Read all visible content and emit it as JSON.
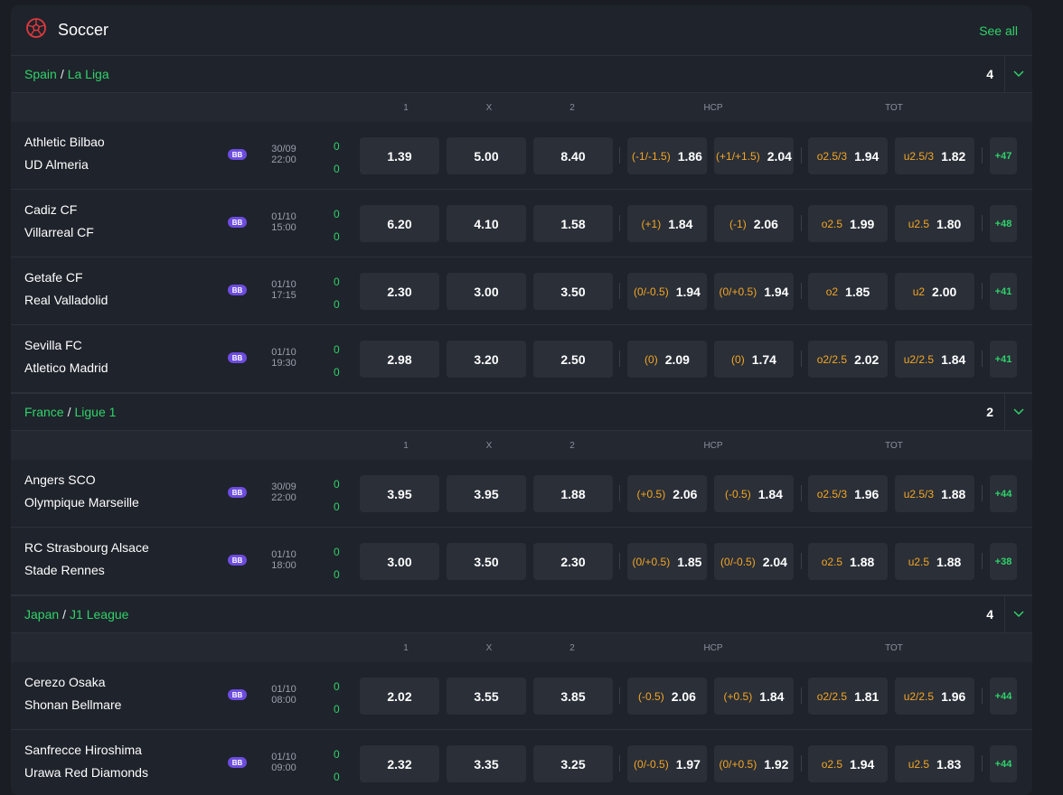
{
  "header": {
    "title": "Soccer",
    "see_all": "See all"
  },
  "columns": {
    "one": "1",
    "x": "X",
    "two": "2",
    "hcp": "HCP",
    "tot": "TOT"
  },
  "colors": {
    "accent": "#2fd36a",
    "line_label": "#f5a623",
    "bb_badge": "#6d4ce0"
  },
  "leagues": [
    {
      "country": "Spain",
      "league": "La Liga",
      "count": "4",
      "matches": [
        {
          "home": "Athletic Bilbao",
          "away": "UD Almeria",
          "badge": "BB",
          "date": "30/09",
          "time": "22:00",
          "score_home": "0",
          "score_away": "0",
          "o1": "1.39",
          "ox": "5.00",
          "o2": "8.40",
          "h1_label": "(-1/-1.5)",
          "h1": "1.86",
          "h2_label": "(+1/+1.5)",
          "h2": "2.04",
          "t1_label": "o2.5/3",
          "t1": "1.94",
          "t2_label": "u2.5/3",
          "t2": "1.82",
          "more": "+47"
        },
        {
          "home": "Cadiz CF",
          "away": "Villarreal CF",
          "badge": "BB",
          "date": "01/10",
          "time": "15:00",
          "score_home": "0",
          "score_away": "0",
          "o1": "6.20",
          "ox": "4.10",
          "o2": "1.58",
          "h1_label": "(+1)",
          "h1": "1.84",
          "h2_label": "(-1)",
          "h2": "2.06",
          "t1_label": "o2.5",
          "t1": "1.99",
          "t2_label": "u2.5",
          "t2": "1.80",
          "more": "+48"
        },
        {
          "home": "Getafe CF",
          "away": "Real Valladolid",
          "badge": "BB",
          "date": "01/10",
          "time": "17:15",
          "score_home": "0",
          "score_away": "0",
          "o1": "2.30",
          "ox": "3.00",
          "o2": "3.50",
          "h1_label": "(0/-0.5)",
          "h1": "1.94",
          "h2_label": "(0/+0.5)",
          "h2": "1.94",
          "t1_label": "o2",
          "t1": "1.85",
          "t2_label": "u2",
          "t2": "2.00",
          "more": "+41"
        },
        {
          "home": "Sevilla FC",
          "away": "Atletico Madrid",
          "badge": "BB",
          "date": "01/10",
          "time": "19:30",
          "score_home": "0",
          "score_away": "0",
          "o1": "2.98",
          "ox": "3.20",
          "o2": "2.50",
          "h1_label": "(0)",
          "h1": "2.09",
          "h2_label": "(0)",
          "h2": "1.74",
          "t1_label": "o2/2.5",
          "t1": "2.02",
          "t2_label": "u2/2.5",
          "t2": "1.84",
          "more": "+41"
        }
      ]
    },
    {
      "country": "France",
      "league": "Ligue 1",
      "count": "2",
      "matches": [
        {
          "home": "Angers SCO",
          "away": "Olympique Marseille",
          "badge": "BB",
          "date": "30/09",
          "time": "22:00",
          "score_home": "0",
          "score_away": "0",
          "o1": "3.95",
          "ox": "3.95",
          "o2": "1.88",
          "h1_label": "(+0.5)",
          "h1": "2.06",
          "h2_label": "(-0.5)",
          "h2": "1.84",
          "t1_label": "o2.5/3",
          "t1": "1.96",
          "t2_label": "u2.5/3",
          "t2": "1.88",
          "more": "+44"
        },
        {
          "home": "RC Strasbourg Alsace",
          "away": "Stade Rennes",
          "badge": "BB",
          "date": "01/10",
          "time": "18:00",
          "score_home": "0",
          "score_away": "0",
          "o1": "3.00",
          "ox": "3.50",
          "o2": "2.30",
          "h1_label": "(0/+0.5)",
          "h1": "1.85",
          "h2_label": "(0/-0.5)",
          "h2": "2.04",
          "t1_label": "o2.5",
          "t1": "1.88",
          "t2_label": "u2.5",
          "t2": "1.88",
          "more": "+38"
        }
      ]
    },
    {
      "country": "Japan",
      "league": "J1 League",
      "count": "4",
      "matches": [
        {
          "home": "Cerezo Osaka",
          "away": "Shonan Bellmare",
          "badge": "BB",
          "date": "01/10",
          "time": "08:00",
          "score_home": "0",
          "score_away": "0",
          "o1": "2.02",
          "ox": "3.55",
          "o2": "3.85",
          "h1_label": "(-0.5)",
          "h1": "2.06",
          "h2_label": "(+0.5)",
          "h2": "1.84",
          "t1_label": "o2/2.5",
          "t1": "1.81",
          "t2_label": "u2/2.5",
          "t2": "1.96",
          "more": "+44"
        },
        {
          "home": "Sanfrecce Hiroshima",
          "away": "Urawa Red Diamonds",
          "badge": "BB",
          "date": "01/10",
          "time": "09:00",
          "score_home": "0",
          "score_away": "0",
          "o1": "2.32",
          "ox": "3.35",
          "o2": "3.25",
          "h1_label": "(0/-0.5)",
          "h1": "1.97",
          "h2_label": "(0/+0.5)",
          "h2": "1.92",
          "t1_label": "o2.5",
          "t1": "1.94",
          "t2_label": "u2.5",
          "t2": "1.83",
          "more": "+44"
        }
      ]
    }
  ]
}
